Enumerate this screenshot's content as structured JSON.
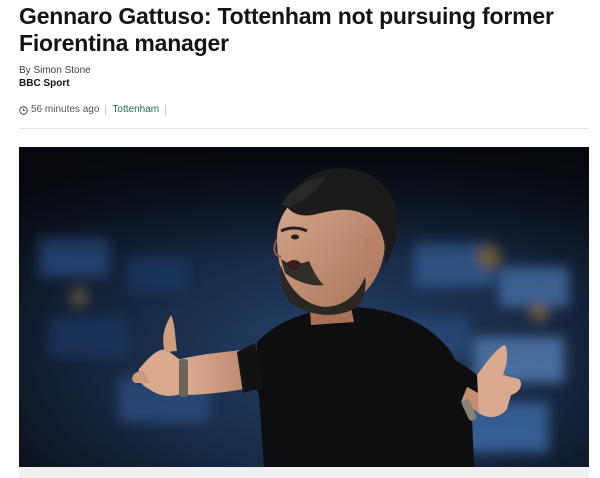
{
  "article": {
    "headline": "Gennaro Gattuso: Tottenham not pursuing former Fiorentina manager",
    "byline": {
      "author": "By Simon Stone",
      "organisation": "BBC Sport"
    },
    "meta": {
      "timestamp": "56 minutes ago",
      "topic": "Tottenham",
      "icons": [
        "clock-icon"
      ]
    },
    "image": {
      "alt": ""
    }
  },
  "colors": {
    "text": "#141414",
    "topic_link": "#1a6b4a",
    "muted": "#545658",
    "divider": "#e3e3e3"
  }
}
